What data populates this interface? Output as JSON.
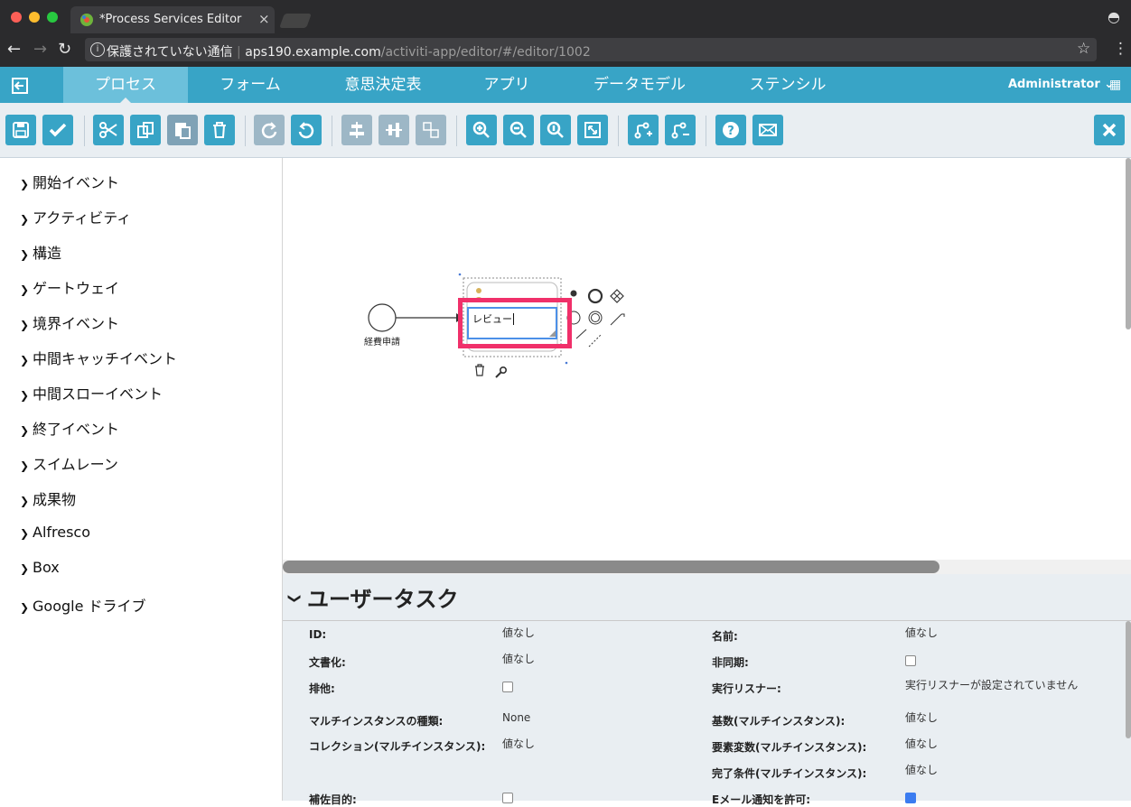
{
  "browser": {
    "tab_title": "*Process Services Editor",
    "security_label": "保護されていない通信",
    "url_host": "aps190.example.com",
    "url_path": "/activiti-app/editor/#/editor/1002"
  },
  "app_nav": {
    "tabs": [
      {
        "label": "プロセス",
        "active": true
      },
      {
        "label": "フォーム"
      },
      {
        "label": "意思決定表"
      },
      {
        "label": "アプリ"
      },
      {
        "label": "データモデル"
      },
      {
        "label": "ステンシル"
      }
    ],
    "user": "Administrator"
  },
  "toolbar": {
    "buttons": [
      "save-icon",
      "validate-icon",
      "cut-icon",
      "copy-icon",
      "paste-icon",
      "delete-icon",
      "redo-icon",
      "undo-icon",
      "align-horizontal-icon",
      "align-vertical-icon",
      "same-size-icon",
      "zoom-in-icon",
      "zoom-out-icon",
      "zoom-actual-icon",
      "zoom-fit-icon",
      "add-bendpoint-icon",
      "remove-bendpoint-icon",
      "help-icon",
      "mail-icon",
      "close-icon"
    ]
  },
  "palette": {
    "items": [
      "開始イベント",
      "アクティビティ",
      "構造",
      "ゲートウェイ",
      "境界イベント",
      "中間キャッチイベント",
      "中間スローイベント",
      "終了イベント",
      "スイムレーン",
      "成果物",
      "Alfresco",
      "Box",
      "Google ドライブ"
    ]
  },
  "canvas": {
    "start_event_label": "経費申請",
    "task_edit_value": "レビュー",
    "highlight_color": "#f0306a"
  },
  "properties": {
    "title": "ユーザータスク",
    "rows": [
      {
        "label": "ID:",
        "value": "値なし"
      },
      {
        "label": "名前:",
        "value": "値なし"
      },
      {
        "label": "文書化:",
        "value": "値なし"
      },
      {
        "label": "非同期:",
        "checkbox": false
      },
      {
        "label": "排他:",
        "checkbox": false
      },
      {
        "label": "実行リスナー:",
        "value": "実行リスナーが設定されていません"
      },
      {
        "label": "マルチインスタンスの種類:",
        "value": "None"
      },
      {
        "label": "基数(マルチインスタンス):",
        "value": "値なし"
      },
      {
        "label": "コレクション(マルチインスタンス):",
        "value": "値なし"
      },
      {
        "label": "要素変数(マルチインスタンス):",
        "value": "値なし"
      },
      {
        "label": "完了条件(マルチインスタンス):",
        "value": "値なし"
      },
      {
        "label": "補佐目的:",
        "checkbox": false
      },
      {
        "label": "Eメール通知を許可:",
        "checkbox": true
      }
    ]
  }
}
